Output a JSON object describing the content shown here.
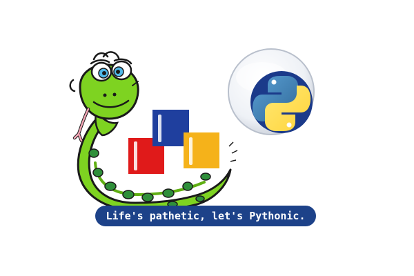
{
  "banner": {
    "slogan": "Life's pathetic, let's Pythonic."
  },
  "colors": {
    "snake_green": "#7ed321",
    "snake_outline": "#1a1a1a",
    "snake_spot": "#2f8f3a",
    "eye_blue": "#4fb8e8",
    "block_red": "#e01a1a",
    "block_blue": "#1f3f9e",
    "block_yellow": "#f5b21a",
    "python_blue": "#3670a0",
    "python_yellow": "#ffd43b",
    "badge_rim": "#dfe3ea",
    "banner_blue": "#1d4289"
  },
  "icons": {
    "mascot": "cartoon-snake-icon",
    "blocks": "stacked-blocks-icon",
    "badge": "python-logo-badge-icon"
  }
}
